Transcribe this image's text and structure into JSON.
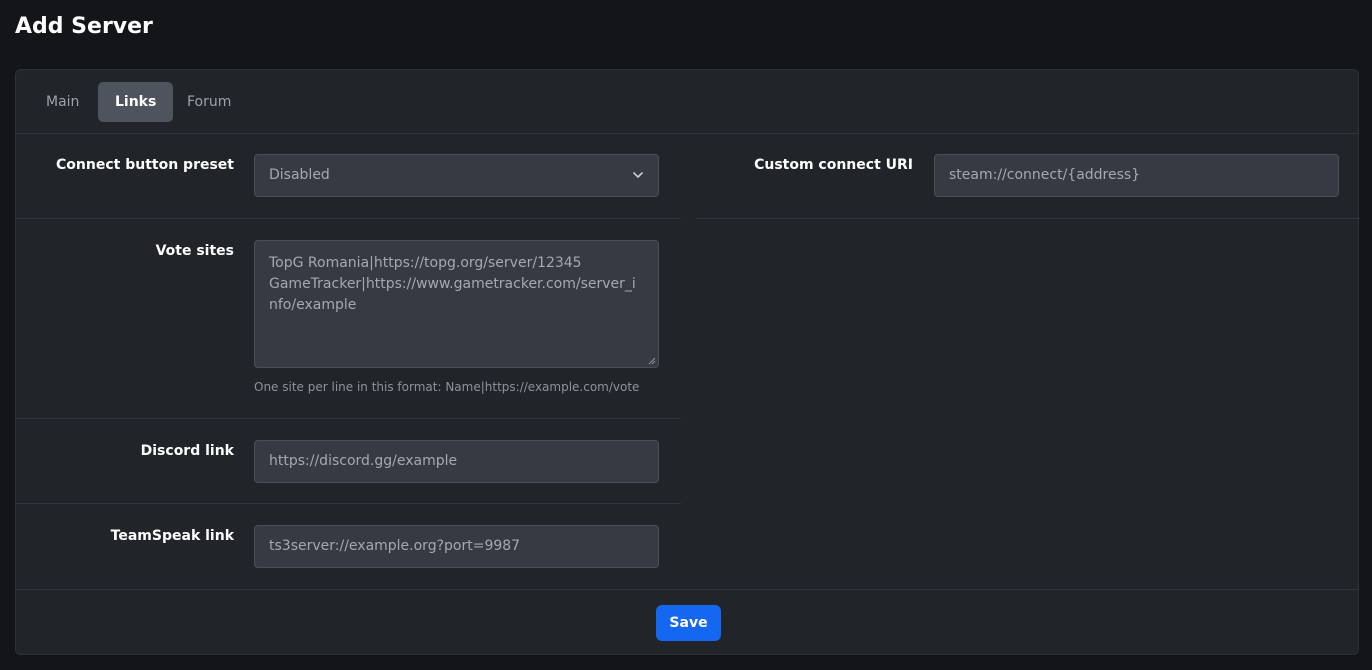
{
  "page": {
    "title": "Add Server"
  },
  "tabs": [
    {
      "label": "Main",
      "active": false
    },
    {
      "label": "Links",
      "active": true
    },
    {
      "label": "Forum",
      "active": false
    }
  ],
  "form": {
    "connect_preset": {
      "label": "Connect button preset",
      "value": "Disabled"
    },
    "custom_uri": {
      "label": "Custom connect URI",
      "placeholder": "steam://connect/{address}"
    },
    "vote_sites": {
      "label": "Vote sites",
      "placeholder": "TopG Romania|https://topg.org/server/12345\nGameTracker|https://www.gametracker.com/server_info/example",
      "help": "One site per line in this format: Name|https://example.com/vote"
    },
    "discord": {
      "label": "Discord link",
      "placeholder": "https://discord.gg/example"
    },
    "teamspeak": {
      "label": "TeamSpeak link",
      "placeholder": "ts3server://example.org?port=9987"
    }
  },
  "actions": {
    "save_label": "Save"
  },
  "colors": {
    "accent": "#1467f0",
    "background": "#131519",
    "card": "#212429",
    "input": "#373a43"
  },
  "icons": {
    "select": "chevron-down-icon",
    "resize": "resize-handle-icon"
  }
}
